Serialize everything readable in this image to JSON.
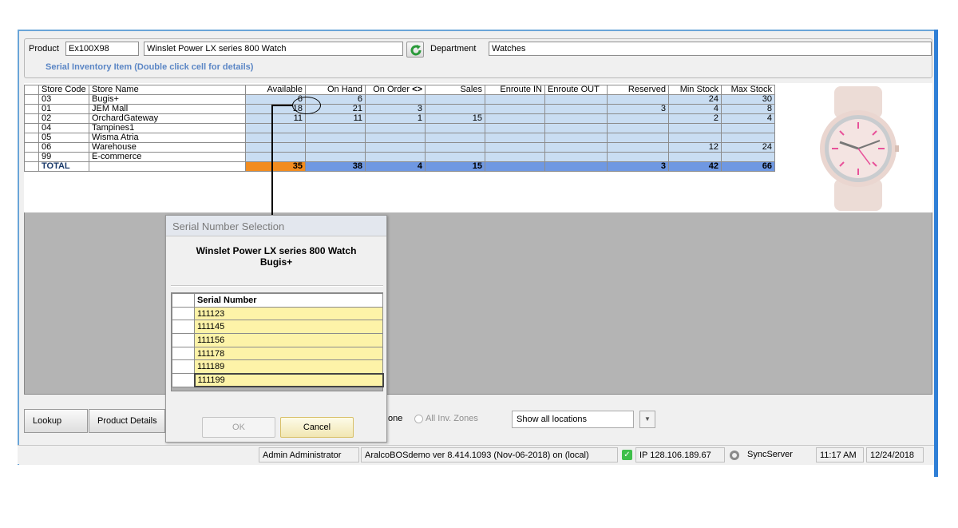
{
  "header": {
    "product_label": "Product",
    "product_code": "Ex100X98",
    "product_name": "Winslet Power LX series 800 Watch",
    "department_label": "Department",
    "department_value": "Watches",
    "serial_note": "Serial Inventory Item (Double click cell for details)"
  },
  "grid": {
    "columns": [
      "Store Code",
      "Store Name",
      "Available",
      "On Hand",
      "On Order",
      "<>",
      "Sales",
      "Enroute IN",
      "Enroute OUT",
      "Reserved",
      "Min Stock",
      "Max Stock"
    ],
    "rows": [
      {
        "code": "03",
        "name": "Bugis+",
        "available": "6",
        "on_hand": "6",
        "on_order": "",
        "sales": "",
        "enroute_in": "",
        "enroute_out": "",
        "reserved": "",
        "min_stock": "24",
        "max_stock": "30"
      },
      {
        "code": "01",
        "name": "JEM Mall",
        "available": "18",
        "on_hand": "21",
        "on_order": "3",
        "sales": "",
        "enroute_in": "",
        "enroute_out": "",
        "reserved": "3",
        "min_stock": "4",
        "max_stock": "8"
      },
      {
        "code": "02",
        "name": "OrchardGateway",
        "available": "11",
        "on_hand": "11",
        "on_order": "1",
        "sales": "15",
        "enroute_in": "",
        "enroute_out": "",
        "reserved": "",
        "min_stock": "2",
        "max_stock": "4"
      },
      {
        "code": "04",
        "name": "Tampines1",
        "available": "",
        "on_hand": "",
        "on_order": "",
        "sales": "",
        "enroute_in": "",
        "enroute_out": "",
        "reserved": "",
        "min_stock": "",
        "max_stock": ""
      },
      {
        "code": "05",
        "name": "Wisma Atria",
        "available": "",
        "on_hand": "",
        "on_order": "",
        "sales": "",
        "enroute_in": "",
        "enroute_out": "",
        "reserved": "",
        "min_stock": "",
        "max_stock": ""
      },
      {
        "code": "06",
        "name": "Warehouse",
        "available": "",
        "on_hand": "",
        "on_order": "",
        "sales": "",
        "enroute_in": "",
        "enroute_out": "",
        "reserved": "",
        "min_stock": "12",
        "max_stock": "24"
      },
      {
        "code": "99",
        "name": "E-commerce",
        "available": "",
        "on_hand": "",
        "on_order": "",
        "sales": "",
        "enroute_in": "",
        "enroute_out": "",
        "reserved": "",
        "min_stock": "",
        "max_stock": ""
      }
    ],
    "total": {
      "label": "TOTAL",
      "available": "35",
      "on_hand": "38",
      "on_order": "4",
      "sales": "15",
      "enroute_in": "",
      "enroute_out": "",
      "reserved": "3",
      "min_stock": "42",
      "max_stock": "66"
    }
  },
  "dialog": {
    "title": "Serial Number Selection",
    "product": "Winslet Power LX series 800 Watch",
    "store": "Bugis+",
    "column": "Serial Number",
    "serials": [
      "111123",
      "111145",
      "111156",
      "111178",
      "111189",
      "111199"
    ],
    "ok_label": "OK",
    "cancel_label": "Cancel"
  },
  "bottom": {
    "lookup_label": "Lookup",
    "product_details_label": "Product Details",
    "zone_partial": "one",
    "all_zones_label": "All Inv. Zones",
    "locations_value": "Show all locations"
  },
  "status": {
    "user": "Admin Administrator",
    "version": "AralcoBOSdemo ver 8.414.1093 (Nov-06-2018) on (local)",
    "ip": "IP 128.106.189.67",
    "sync": "SyncServer",
    "time": "11:17 AM",
    "date": "12/24/2018"
  },
  "colors": {
    "accent": "#2f7fd6",
    "cell_blue": "#c9ddf2",
    "total_blue": "#6f98e2",
    "total_orange": "#f28c1f",
    "serial_yellow": "#fdf3a8"
  }
}
